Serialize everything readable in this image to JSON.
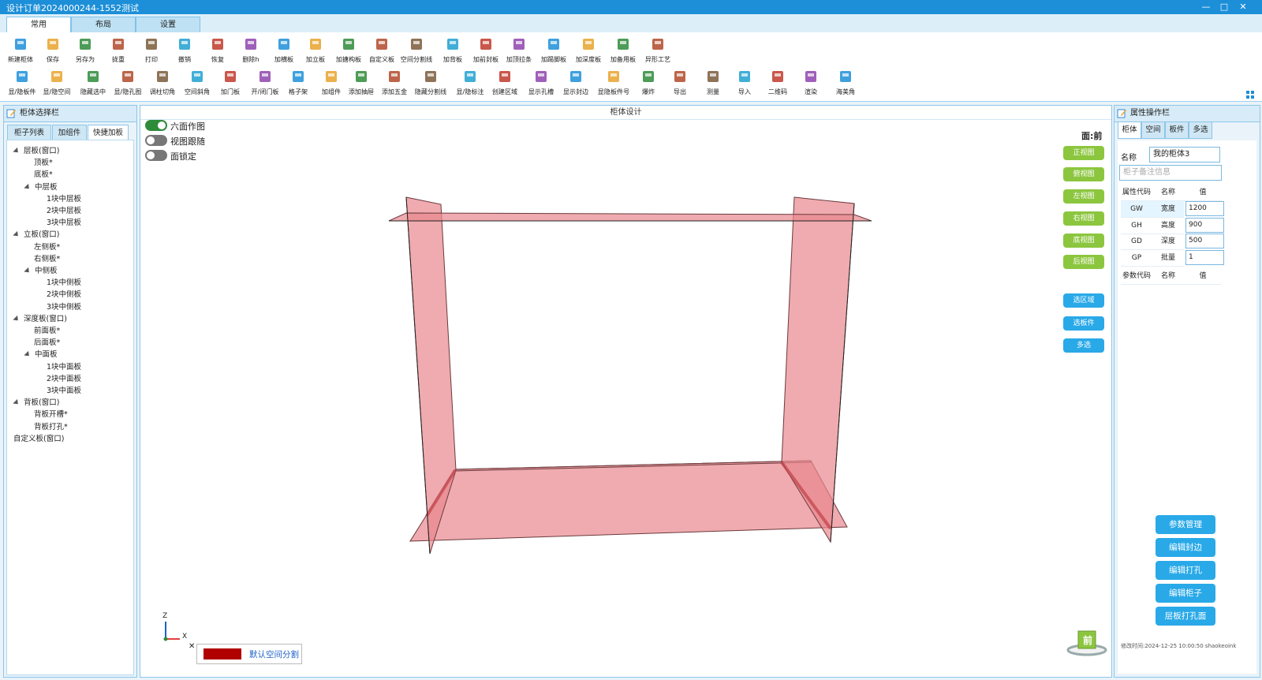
{
  "window": {
    "title": "设计订单2024000244-1552测试"
  },
  "ribbon_tabs": [
    "常用",
    "布局",
    "设置"
  ],
  "toolbar_row1": [
    {
      "label": "新建柜体",
      "icon": "new-cabinet-icon"
    },
    {
      "label": "保存",
      "icon": "save-icon"
    },
    {
      "label": "另存为",
      "icon": "save-as-icon"
    },
    {
      "label": "拢重",
      "icon": "reload-icon"
    },
    {
      "label": "打印",
      "icon": "print-icon"
    },
    {
      "label": "撤销",
      "icon": "undo-icon"
    },
    {
      "label": "恢复",
      "icon": "redo-icon"
    },
    {
      "label": "删除h",
      "icon": "delete-icon"
    },
    {
      "label": "加横板",
      "icon": "add-horizontal-board-icon"
    },
    {
      "label": "加立板",
      "icon": "add-vertical-board-icon"
    },
    {
      "label": "加搪构板",
      "icon": "add-frame-board-icon"
    },
    {
      "label": "自定义板",
      "icon": "custom-board-icon"
    },
    {
      "label": "空间分割线",
      "icon": "space-split-icon"
    },
    {
      "label": "加背板",
      "icon": "add-back-board-icon"
    },
    {
      "label": "加前封板",
      "icon": "add-front-board-icon"
    },
    {
      "label": "加顶拉条",
      "icon": "add-top-strip-icon"
    },
    {
      "label": "加踢脚板",
      "icon": "add-kickboard-icon"
    },
    {
      "label": "加深度板",
      "icon": "add-depth-board-icon"
    },
    {
      "label": "加备用板",
      "icon": "add-spare-board-icon"
    },
    {
      "label": "异形工艺",
      "icon": "special-process-icon"
    }
  ],
  "toolbar_row2": [
    {
      "label": "显/隐板件",
      "icon": "toggle-board-icon"
    },
    {
      "label": "显/隐空间",
      "icon": "toggle-space-icon"
    },
    {
      "label": "隐藏选中",
      "icon": "hide-selected-icon"
    },
    {
      "label": "显/隐孔图",
      "icon": "toggle-hole-icon"
    },
    {
      "label": "调柱切角",
      "icon": "column-cut-icon"
    },
    {
      "label": "空间斜角",
      "icon": "space-bevel-icon"
    },
    {
      "label": "加门板",
      "icon": "add-door-icon"
    },
    {
      "label": "开/闭门板",
      "icon": "open-door-icon"
    },
    {
      "label": "格子架",
      "icon": "grid-rack-icon"
    },
    {
      "label": "加组件",
      "icon": "add-component-icon"
    },
    {
      "label": "添加抽屉",
      "icon": "add-drawer-icon"
    },
    {
      "label": "添加五金",
      "icon": "add-hardware-icon"
    },
    {
      "label": "隐藏分割线",
      "icon": "hide-split-icon"
    },
    {
      "label": "显/隐标注",
      "icon": "toggle-dimension-icon"
    },
    {
      "label": "创建区域",
      "icon": "create-region-icon"
    },
    {
      "label": "显示孔槽",
      "icon": "show-slot-icon"
    },
    {
      "label": "显示封边",
      "icon": "show-edge-icon"
    },
    {
      "label": "显隐板件号",
      "icon": "board-number-icon"
    },
    {
      "label": "爆炸",
      "icon": "explode-icon"
    },
    {
      "label": "导出",
      "icon": "export-icon"
    },
    {
      "label": "测量",
      "icon": "measure-icon"
    },
    {
      "label": "导入",
      "icon": "import-icon"
    },
    {
      "label": "二维码",
      "icon": "qrcode-icon"
    },
    {
      "label": "渲染",
      "icon": "render-icon"
    },
    {
      "label": "海美角",
      "icon": "corner-icon"
    }
  ],
  "left_panel": {
    "title": "柜体选择栏",
    "tabs": [
      "柜子列表",
      "加组件",
      "快捷加板"
    ],
    "tree": [
      {
        "label": "层板(窗口)",
        "level": 0,
        "expanded": true
      },
      {
        "label": "顶板*",
        "level": 1
      },
      {
        "label": "底板*",
        "level": 1
      },
      {
        "label": "中层板",
        "level": 1,
        "expanded": true
      },
      {
        "label": "1块中层板",
        "level": 2
      },
      {
        "label": "2块中层板",
        "level": 2
      },
      {
        "label": "3块中层板",
        "level": 2
      },
      {
        "label": "立板(窗口)",
        "level": 0,
        "expanded": true
      },
      {
        "label": "左侧板*",
        "level": 1
      },
      {
        "label": "右侧板*",
        "level": 1
      },
      {
        "label": "中侧板",
        "level": 1,
        "expanded": true
      },
      {
        "label": "1块中侧板",
        "level": 2
      },
      {
        "label": "2块中侧板",
        "level": 2
      },
      {
        "label": "3块中侧板",
        "level": 2
      },
      {
        "label": "深度板(窗口)",
        "level": 0,
        "expanded": true
      },
      {
        "label": "前面板*",
        "level": 1
      },
      {
        "label": "后面板*",
        "level": 1
      },
      {
        "label": "中面板",
        "level": 1,
        "expanded": true
      },
      {
        "label": "1块中面板",
        "level": 2
      },
      {
        "label": "2块中面板",
        "level": 2
      },
      {
        "label": "3块中面板",
        "level": 2
      },
      {
        "label": "背板(窗口)",
        "level": 0,
        "expanded": true
      },
      {
        "label": "背板开槽*",
        "level": 1
      },
      {
        "label": "背板打孔*",
        "level": 1
      },
      {
        "label": "自定义板(窗口)",
        "level": 0
      }
    ]
  },
  "center": {
    "title": "柜体设计",
    "toggles": [
      {
        "label": "六面作图",
        "on": true
      },
      {
        "label": "视图跟随",
        "on": false
      },
      {
        "label": "面锁定",
        "on": false
      }
    ],
    "face_indicator": "面:前",
    "view_buttons": [
      "正视图",
      "俯视图",
      "左视图",
      "右视图",
      "底视图",
      "后视图"
    ],
    "select_buttons": [
      "选区域",
      "选板件",
      "多选"
    ],
    "axis": {
      "z": "Z",
      "x": "X"
    },
    "legend_label": "默认空间分割",
    "legend_color": "#b00000",
    "cube_label": "前",
    "board_color": "#e8878d"
  },
  "right_panel": {
    "title": "属性操作栏",
    "tabs": [
      "柜体",
      "空间",
      "板件",
      "多选"
    ],
    "name_label": "名称",
    "name_value": "我的柜体3",
    "remark_placeholder": "柜子备注信息",
    "attr_headers": [
      "属性代码",
      "名称",
      "值"
    ],
    "attributes": [
      {
        "code": "GW",
        "name": "宽度",
        "value": "1200"
      },
      {
        "code": "GH",
        "name": "高度",
        "value": "900"
      },
      {
        "code": "GD",
        "name": "深度",
        "value": "500"
      },
      {
        "code": "GP",
        "name": "批量",
        "value": "1"
      }
    ],
    "param_headers": [
      "参数代码",
      "名称",
      "值"
    ],
    "actions": [
      "参数管理",
      "编辑封边",
      "编辑打孔",
      "编辑柜子",
      "层板打孔面"
    ],
    "footer": "修改时间:2024-12-25 10:00:50 shaokeoink"
  }
}
